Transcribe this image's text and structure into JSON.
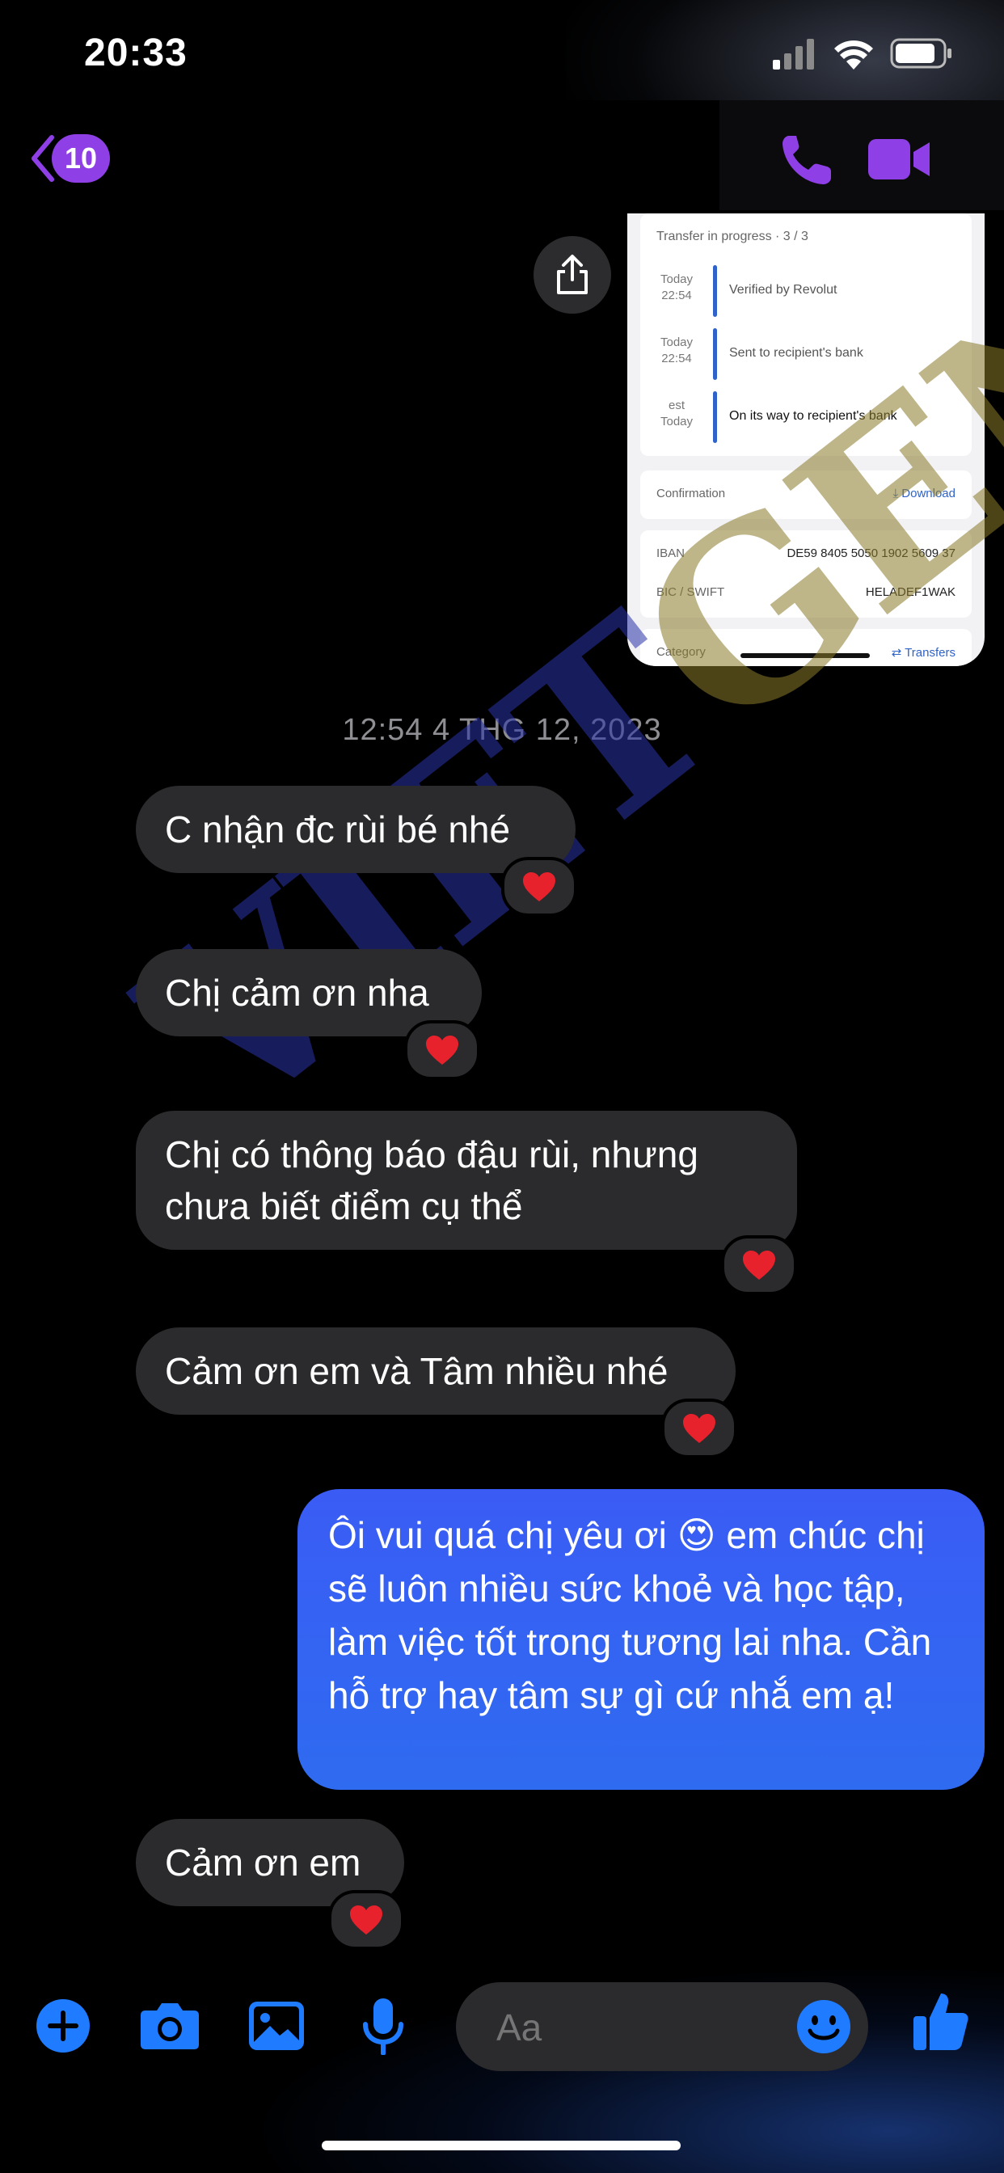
{
  "status": {
    "time": "20:33"
  },
  "header": {
    "unread_count": "10"
  },
  "attachment": {
    "transfer_title": "Transfer in progress · 3 / 3",
    "timeline": [
      {
        "when_line1": "Today",
        "when_line2": "22:54",
        "label": "Verified by Revolut"
      },
      {
        "when_line1": "Today",
        "when_line2": "22:54",
        "label": "Sent to recipient's bank"
      },
      {
        "when_line1": "est",
        "when_line2": "Today",
        "label": "On its way to recipient's bank"
      }
    ],
    "confirmation_label": "Confirmation",
    "download_label": "Download",
    "iban_label": "IBAN",
    "iban_value": "DE59 8405 5050 1902 5609 37",
    "bic_label": "BIC / SWIFT",
    "bic_value": "HELADEF1WAK",
    "category_label": "Category",
    "category_value": "Transfers"
  },
  "timestamp": "12:54 4 THG 12, 2023",
  "messages": [
    {
      "text": "C nhận đc rùi bé nhé",
      "reaction": "❤️"
    },
    {
      "text": "Chị cảm ơn nha",
      "reaction": "❤️"
    },
    {
      "text": "Chị có thông báo đậu rùi, nhưng chưa biết điểm cụ thể",
      "reaction": "❤️"
    },
    {
      "text": "Cảm ơn em và Tâm nhiều nhé",
      "reaction": "❤️"
    },
    {
      "text": "Ôi vui quá chị yêu ơi 😍 em chúc chị sẽ luôn nhiều sức khoẻ và học tập, làm việc tốt trong tương lai nha. Cần hỗ trợ hay tâm sự gì cứ nhắ em ạ!"
    },
    {
      "text": "Cảm ơn em",
      "reaction": "❤️"
    }
  ],
  "watermark": {
    "part1": "VIET",
    "part2": "GEN"
  },
  "composer": {
    "placeholder": "Aa"
  },
  "colors": {
    "accent_purple": "#8f3fe6",
    "messenger_blue": "#1f7bff",
    "outgoing_bubble": "#3a5cf5",
    "incoming_bubble": "#2b2b2d"
  }
}
